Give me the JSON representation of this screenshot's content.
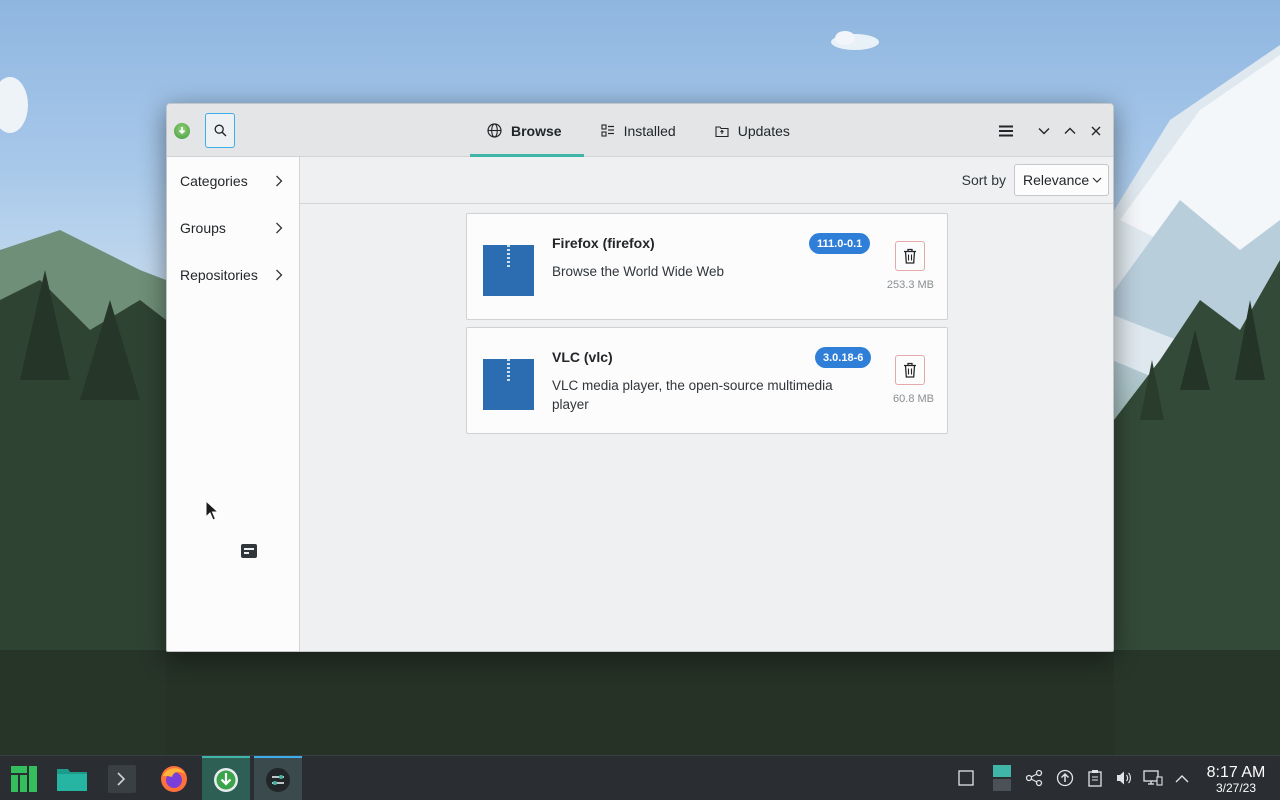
{
  "window": {
    "tabs": [
      {
        "label": "Browse",
        "icon": "globe-icon",
        "active": true
      },
      {
        "label": "Installed",
        "icon": "installed-list-icon",
        "active": false
      },
      {
        "label": "Updates",
        "icon": "updates-icon",
        "active": false
      }
    ]
  },
  "sidebar": {
    "items": [
      {
        "label": "Categories"
      },
      {
        "label": "Groups"
      },
      {
        "label": "Repositories"
      }
    ]
  },
  "sort": {
    "label": "Sort by",
    "value": "Relevance"
  },
  "packages": [
    {
      "name": "Firefox (firefox)",
      "description": "Browse the World Wide Web",
      "version": "111.0-0.1",
      "size": "253.3 MB"
    },
    {
      "name": "VLC (vlc)",
      "description": "VLC media player, the open-source multimedia player",
      "version": "3.0.18-6",
      "size": "60.8 MB"
    }
  ],
  "taskbar": {
    "time": "8:17 AM",
    "date": "3/27/23",
    "apps": [
      "manjaro-menu-icon",
      "file-manager-icon",
      "terminal-icon",
      "firefox-icon",
      "software-center-icon",
      "settings-icon"
    ]
  },
  "colors": {
    "accent": "#3fb6a8",
    "badge": "#2f7fd8",
    "trash_border": "#e6a8a8"
  }
}
